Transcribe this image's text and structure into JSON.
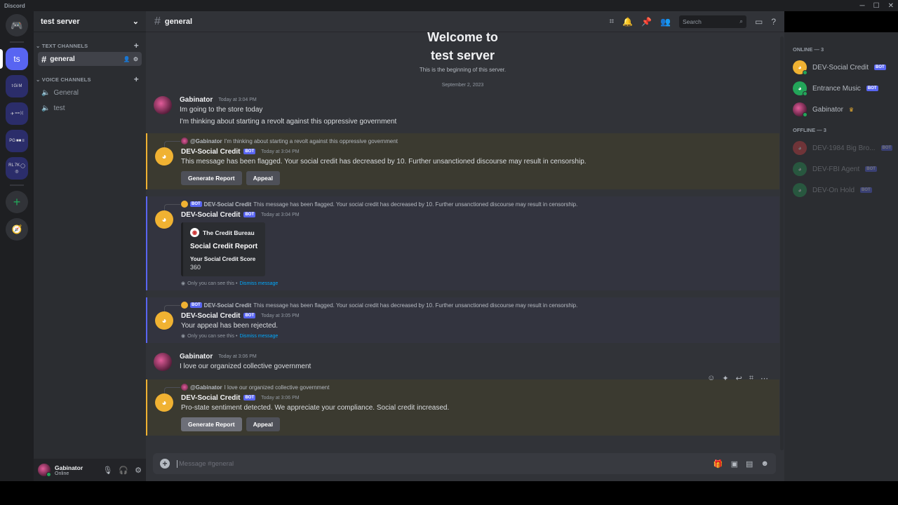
{
  "app": {
    "title": "Discord"
  },
  "colors": {
    "accent": "#5865f2",
    "flagged": "#f0b232",
    "online": "#23a559",
    "link": "#00a8fc"
  },
  "rail": {
    "active_server": "ts",
    "folders": [
      [
        "t",
        "Gi",
        "M",
        ""
      ],
      [
        "✈",
        "==",
        "ᛞ",
        ""
      ],
      [
        "PG",
        "■■",
        "≡",
        ""
      ],
      [
        "RL",
        "7K",
        "◯",
        "◎"
      ]
    ]
  },
  "server": {
    "name": "test server"
  },
  "channels": {
    "text_category": "TEXT CHANNELS",
    "text": [
      {
        "name": "general",
        "selected": true
      }
    ],
    "voice_category": "VOICE CHANNELS",
    "voice": [
      {
        "name": "General"
      },
      {
        "name": "test"
      }
    ]
  },
  "user": {
    "name": "Gabinator",
    "status": "Online"
  },
  "header": {
    "channel": "general",
    "search_placeholder": "Search"
  },
  "welcome": {
    "line1": "Welcome to",
    "line2": "test server",
    "subtitle": "This is the beginning of this server.",
    "date": "September 2, 2023"
  },
  "messages": [
    {
      "author": "Gabinator",
      "time": "Today at 3:04 PM",
      "lines": [
        "Im going to the store today",
        "I'm thinking about starting a revolt against this oppressive government"
      ]
    },
    {
      "reply_to": "@Gabinator",
      "reply_text": "I'm thinking about starting a revolt against this oppressive government",
      "author": "DEV-Social Credit",
      "bot": "BOT",
      "time": "Today at 3:04 PM",
      "text": "This message has been flagged. Your social credit has decreased by 10. Further unsanctioned discourse may result in censorship.",
      "buttons": [
        "Generate Report",
        "Appeal"
      ]
    },
    {
      "reply_to": "DEV-Social Credit",
      "reply_bot": "BOT",
      "reply_text": "This message has been flagged. Your social credit has decreased by 10. Further unsanctioned discourse may result in censorship.",
      "author": "DEV-Social Credit",
      "bot": "BOT",
      "time": "Today at 3:04 PM",
      "embed": {
        "author": "The Credit Bureau",
        "title": "Social Credit Report",
        "field_name": "Your Social Credit Score",
        "field_value": "360"
      },
      "ephemeral": "Only you can see this •",
      "dismiss": "Dismiss message"
    },
    {
      "reply_to": "DEV-Social Credit",
      "reply_bot": "BOT",
      "reply_text": "This message has been flagged. Your social credit has decreased by 10. Further unsanctioned discourse may result in censorship.",
      "author": "DEV-Social Credit",
      "bot": "BOT",
      "time": "Today at 3:05 PM",
      "text": "Your appeal has been rejected.",
      "ephemeral": "Only you can see this •",
      "dismiss": "Dismiss message"
    },
    {
      "author": "Gabinator",
      "time": "Today at 3:06 PM",
      "text": "I love our organized collective government"
    },
    {
      "reply_to": "@Gabinator",
      "reply_text": "I love our organized collective government",
      "author": "DEV-Social Credit",
      "bot": "BOT",
      "time": "Today at 3:06 PM",
      "text": "Pro-state sentiment detected. We appreciate your compliance. Social credit increased.",
      "buttons": [
        "Generate Report",
        "Appeal"
      ]
    }
  ],
  "composer": {
    "placeholder": "Message #general"
  },
  "members": {
    "online_label": "ONLINE — 3",
    "online": [
      {
        "name": "DEV-Social Credit",
        "bot": "BOT",
        "color": "#f0b232"
      },
      {
        "name": "Entrance Music",
        "bot": "BOT",
        "color": "#23a559"
      },
      {
        "name": "Gabinator",
        "crown": "♛"
      }
    ],
    "offline_label": "OFFLINE — 3",
    "offline": [
      {
        "name": "DEV-1984 Big Bro...",
        "bot": "BOT",
        "color": "#ed4245"
      },
      {
        "name": "DEV-FBI Agent",
        "bot": "BOT",
        "color": "#23a559"
      },
      {
        "name": "DEV-On Hold",
        "bot": "BOT",
        "color": "#23a559"
      }
    ]
  }
}
